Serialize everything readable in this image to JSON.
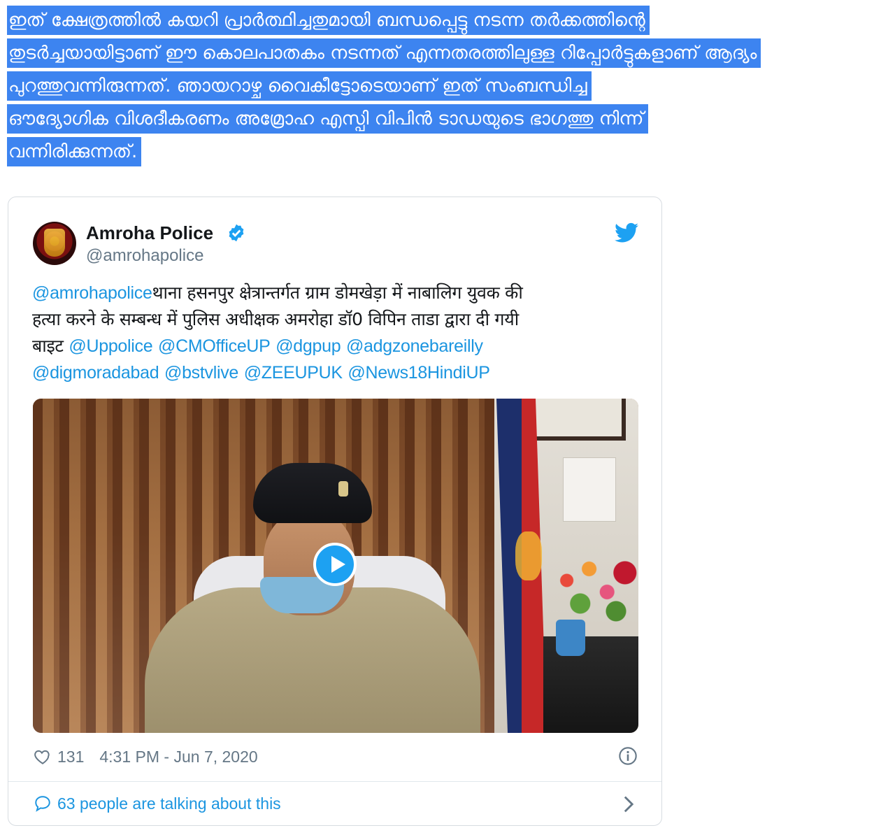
{
  "article": {
    "lines": [
      "ഇത് ക്ഷേത്രത്തിൽ കയറി പ്രാർത്ഥിച്ചതുമായി ബന്ധപ്പെട്ടു നടന്ന തർക്കത്തിന്റെ",
      "തുടർച്ചയായിട്ടാണ് ഈ കൊലപാതകം നടന്നത് എന്നതരത്തിലുള്ള  റിപ്പോർട്ടുകളാണ് ആദ്യം",
      "പുറത്തുവന്നിരുന്നത്. ഞായറാഴ്ച വൈകീട്ടോടെയാണ് ഇത് സംബന്ധിച്ച",
      "ഔദ്യോഗിക വിശദീകരണം അമ്രോഹ എസ്പി വിപിൻ ടാഡയുടെ ഭാഗത്തു നിന്ന്",
      "വന്നിരിക്കുന്നത്."
    ],
    "selection_color": "#3d84f0"
  },
  "tweet": {
    "display_name": "Amroha Police",
    "handle": "@amrohapolice",
    "verified_icon": "verified-badge-icon",
    "brand_icon": "twitter-bird-icon",
    "brand_color": "#1da1f2",
    "text": {
      "mention_lead": "@amrohapolice",
      "body_line1": "थाना हसनपुर क्षेत्रान्तर्गत ग्राम डोमखेड़ा में नाबालिग युवक की",
      "body_line2": "हत्या करने के सम्बन्ध में पुलिस अधीक्षक अमरोहा डॉ0 विपिन ताडा द्वारा दी गयी",
      "body_line3": "बाइट",
      "mentions_line3": [
        "@Uppolice",
        "@CMOfficeUP",
        "@dgpup",
        "@adgzonebareilly"
      ],
      "mentions_line4": [
        "@digmoradabad",
        "@bstvlive",
        "@ZEEUPUK",
        "@News18HindiUP"
      ]
    },
    "media": {
      "type": "video",
      "play_icon": "play-icon"
    },
    "likes": "131",
    "timestamp": "4:31 PM - Jun 7, 2020",
    "talking": "63 people are talking about this",
    "link_color": "#1b95e0"
  }
}
